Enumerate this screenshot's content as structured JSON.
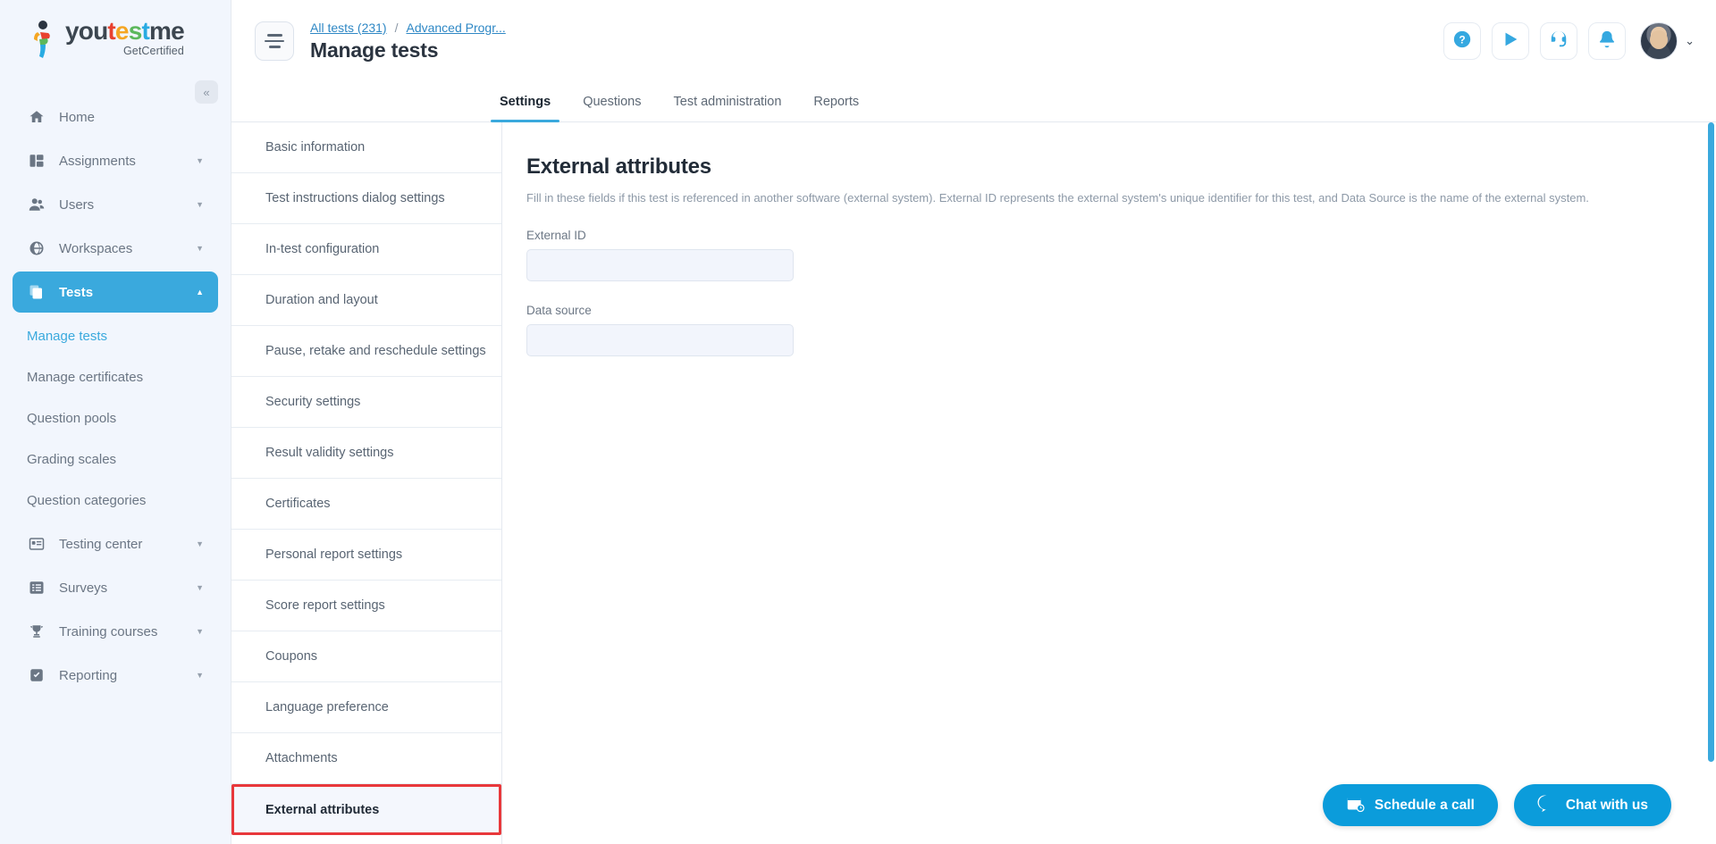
{
  "brand": {
    "name_parts": [
      "you",
      "t",
      "e",
      "s",
      "t",
      "me"
    ],
    "you": "you",
    "t1": "t",
    "e1": "e",
    "s1": "s",
    "t2": "t",
    "me": "me",
    "subtitle": "GetCertified",
    "accent": "#3aa9dd"
  },
  "sidebar": {
    "collapse_glyph": "«",
    "items": [
      {
        "label": "Home",
        "icon": "home-icon",
        "has_caret": false,
        "active": false
      },
      {
        "label": "Assignments",
        "icon": "assignments-icon",
        "has_caret": true,
        "active": false
      },
      {
        "label": "Users",
        "icon": "users-icon",
        "has_caret": true,
        "active": false
      },
      {
        "label": "Workspaces",
        "icon": "globe-icon",
        "has_caret": true,
        "active": false
      },
      {
        "label": "Tests",
        "icon": "tests-icon",
        "has_caret": true,
        "active": true
      }
    ],
    "tests_subitems": [
      {
        "label": "Manage tests",
        "current": true
      },
      {
        "label": "Manage certificates",
        "current": false
      },
      {
        "label": "Question pools",
        "current": false
      },
      {
        "label": "Grading scales",
        "current": false
      },
      {
        "label": "Question categories",
        "current": false
      }
    ],
    "items_after": [
      {
        "label": "Testing center",
        "icon": "testing-center-icon",
        "has_caret": true
      },
      {
        "label": "Surveys",
        "icon": "surveys-icon",
        "has_caret": true
      },
      {
        "label": "Training courses",
        "icon": "trophy-icon",
        "has_caret": true
      },
      {
        "label": "Reporting",
        "icon": "reporting-icon",
        "has_caret": true
      }
    ]
  },
  "header": {
    "breadcrumb": [
      {
        "label": "All tests (231)",
        "link": true
      },
      {
        "label": "/",
        "link": false
      },
      {
        "label": "Advanced Progr...",
        "link": true
      }
    ],
    "bc_all_tests": "All tests (231)",
    "bc_sep": "/",
    "bc_current": "Advanced Progr...",
    "page_title": "Manage tests",
    "actions": [
      {
        "name": "help-icon",
        "label": "Help"
      },
      {
        "name": "play-icon",
        "label": "Play tutorial"
      },
      {
        "name": "headset-icon",
        "label": "Support"
      },
      {
        "name": "bell-icon",
        "label": "Notifications"
      }
    ],
    "avatar_caret": "⌄"
  },
  "tabs": [
    {
      "label": "Settings",
      "active": true
    },
    {
      "label": "Questions",
      "active": false
    },
    {
      "label": "Test administration",
      "active": false
    },
    {
      "label": "Reports",
      "active": false
    }
  ],
  "settings_list": [
    {
      "label": "Basic information",
      "selected": false
    },
    {
      "label": "Test instructions dialog settings",
      "selected": false
    },
    {
      "label": "In-test configuration",
      "selected": false
    },
    {
      "label": "Duration and layout",
      "selected": false
    },
    {
      "label": "Pause, retake and reschedule settings",
      "selected": false
    },
    {
      "label": "Security settings",
      "selected": false
    },
    {
      "label": "Result validity settings",
      "selected": false
    },
    {
      "label": "Certificates",
      "selected": false
    },
    {
      "label": "Personal report settings",
      "selected": false
    },
    {
      "label": "Score report settings",
      "selected": false
    },
    {
      "label": "Coupons",
      "selected": false
    },
    {
      "label": "Language preference",
      "selected": false
    },
    {
      "label": "Attachments",
      "selected": false
    },
    {
      "label": "External attributes",
      "selected": true
    }
  ],
  "panel": {
    "title": "External attributes",
    "description": "Fill in these fields if this test is referenced in another software (external system). External ID represents the external system's unique identifier for this test, and Data Source is the name of the external system.",
    "fields": [
      {
        "label": "External ID",
        "value": "",
        "placeholder": ""
      },
      {
        "label": "Data source",
        "value": "",
        "placeholder": ""
      }
    ],
    "external_id_label": "External ID",
    "external_id_value": "",
    "data_source_label": "Data source",
    "data_source_value": ""
  },
  "floating": {
    "schedule_label": "Schedule a call",
    "chat_label": "Chat with us",
    "color": "#0b9cdb"
  },
  "highlight": {
    "color": "#e8383b",
    "target": "External attributes"
  }
}
